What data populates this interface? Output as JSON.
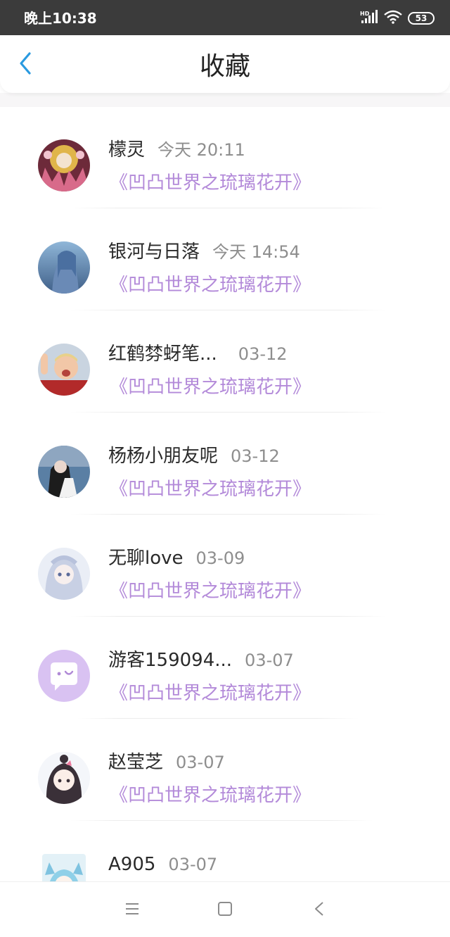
{
  "status_bar": {
    "time": "晚上10:38",
    "network_label": "HD",
    "battery": "53",
    "icons": [
      "signal-icon",
      "wifi-icon",
      "battery-icon"
    ]
  },
  "header": {
    "title": "收藏",
    "back_icon": "chevron-left-icon",
    "accent_color": "#2a9ae0"
  },
  "list": {
    "work_color": "#b38ad9",
    "items": [
      {
        "name": "檬灵",
        "time": "今天 20:11",
        "work": "《凹凸世界之琉璃花开》",
        "avatar": "user-avatar"
      },
      {
        "name": "银河与日落",
        "time": "今天 14:54",
        "work": "《凹凸世界之琉璃花开》",
        "avatar": "user-avatar"
      },
      {
        "name": "红鹤棼蚜笔...",
        "time": "03-12",
        "work": "《凹凸世界之琉璃花开》",
        "avatar": "user-avatar"
      },
      {
        "name": "杨杨小朋友呢",
        "time": "03-12",
        "work": "《凹凸世界之琉璃花开》",
        "avatar": "user-avatar"
      },
      {
        "name": "无聊love",
        "time": "03-09",
        "work": "《凹凸世界之琉璃花开》",
        "avatar": "user-avatar"
      },
      {
        "name": "游客159094...",
        "time": "03-07",
        "work": "《凹凸世界之琉璃花开》",
        "avatar": "default-avatar-chat-icon"
      },
      {
        "name": "赵莹芝",
        "time": "03-07",
        "work": "《凹凸世界之琉璃花开》",
        "avatar": "user-avatar"
      },
      {
        "name": "A905",
        "time": "03-07",
        "work": "",
        "avatar": "user-avatar"
      }
    ]
  },
  "nav_bar": {
    "buttons": [
      "menu-icon",
      "home-square-icon",
      "back-triangle-icon"
    ]
  }
}
